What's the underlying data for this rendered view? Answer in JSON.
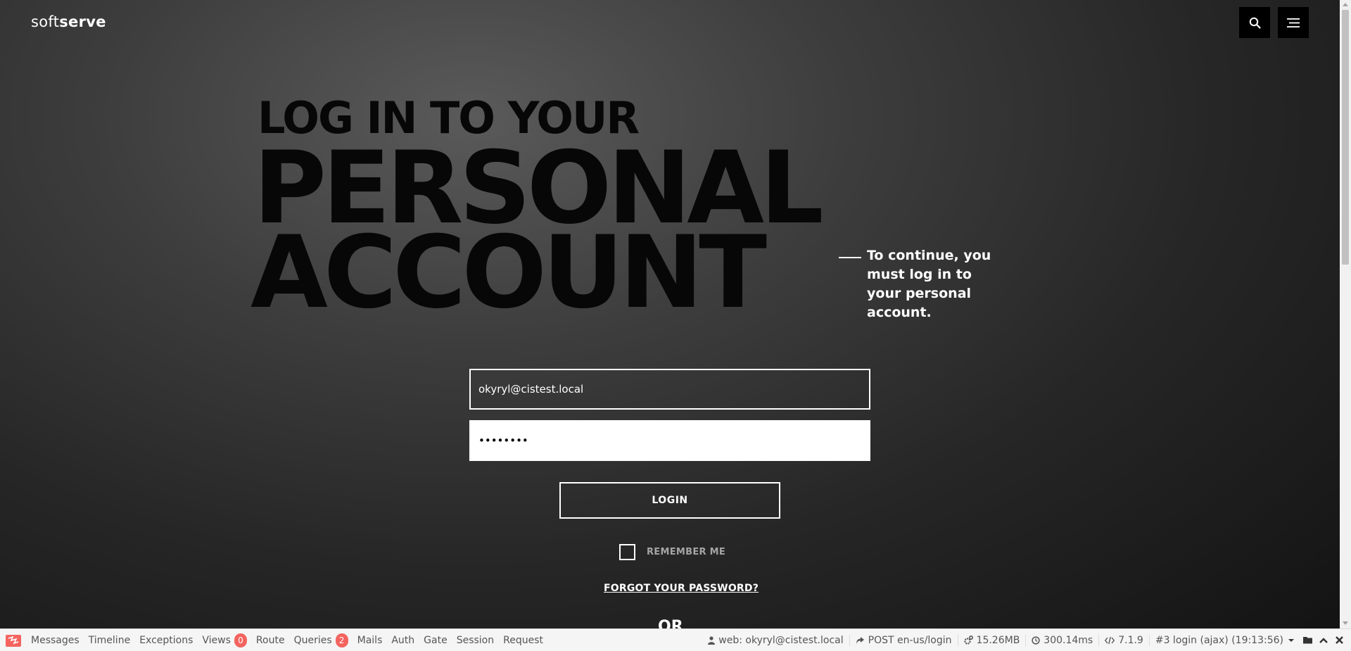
{
  "header": {
    "logo_light": "soft",
    "logo_bold": "serve",
    "search_icon": "search-icon",
    "menu_icon": "hamburger-menu-icon"
  },
  "hero": {
    "line1": "LOG IN TO YOUR",
    "line2": "PERSONAL",
    "line3": "ACCOUNT",
    "aside": "To continue, you must log in to your personal account."
  },
  "form": {
    "email_value": "okyryl@cistest.local",
    "password_value": "••••••••",
    "login_label": "LOGIN",
    "remember_label": "REMEMBER ME",
    "forgot_label": "FORGOT YOUR PASSWORD?",
    "or_label": "OR"
  },
  "debugbar": {
    "tabs": [
      {
        "label": "Messages"
      },
      {
        "label": "Timeline"
      },
      {
        "label": "Exceptions"
      },
      {
        "label": "Views",
        "badge": "0"
      },
      {
        "label": "Route"
      },
      {
        "label": "Queries",
        "badge": "2"
      },
      {
        "label": "Mails"
      },
      {
        "label": "Auth"
      },
      {
        "label": "Gate"
      },
      {
        "label": "Session"
      },
      {
        "label": "Request"
      }
    ],
    "user": "web: okyryl@cistest.local",
    "route": "POST en-us/login",
    "memory": "15.26MB",
    "time": "300.14ms",
    "php_version": "7.1.9",
    "request_select": "#3 login (ajax) (19:13:56)",
    "colors": {
      "badge": "#f4645f",
      "logo": "#f4645f"
    }
  }
}
